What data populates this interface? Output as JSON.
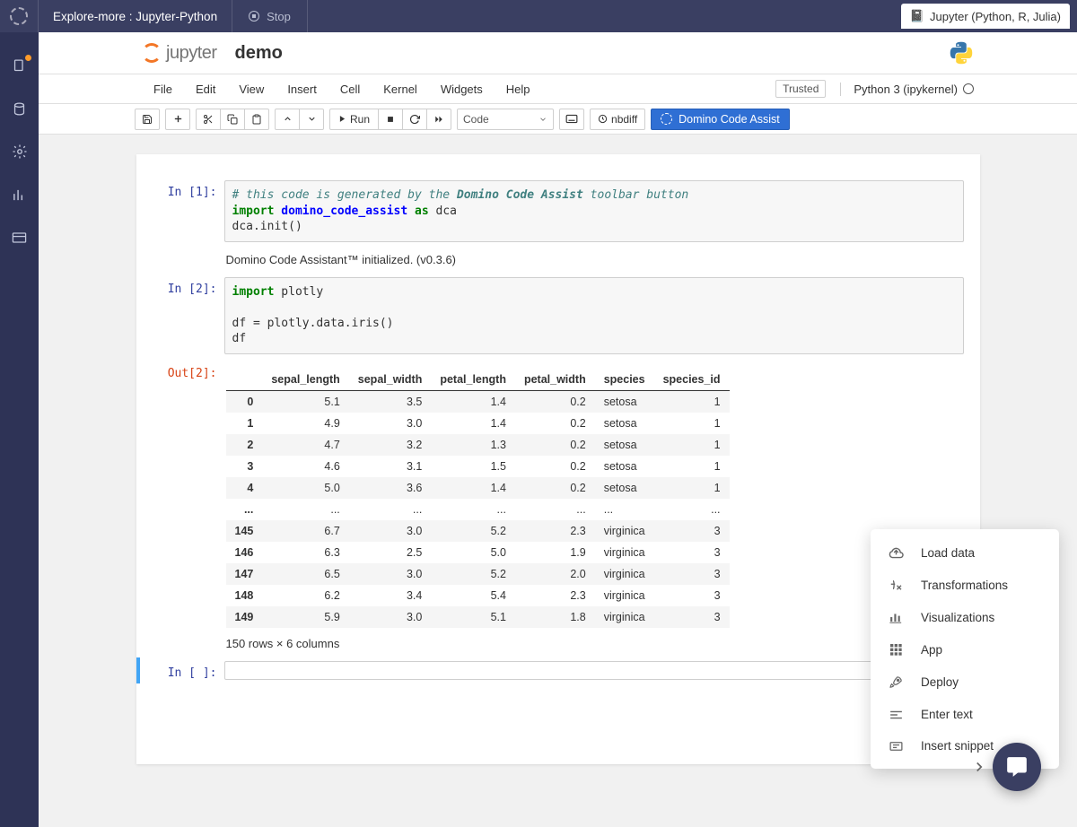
{
  "topbar": {
    "title": "Explore-more : Jupyter-Python",
    "stop_label": "Stop",
    "kernel_tab": "Jupyter (Python, R, Julia)"
  },
  "notebook": {
    "logo_text": "jupyter",
    "name": "demo",
    "trusted": "Trusted",
    "kernel": "Python 3 (ipykernel)"
  },
  "menu": {
    "items": [
      "File",
      "Edit",
      "View",
      "Insert",
      "Cell",
      "Kernel",
      "Widgets",
      "Help"
    ]
  },
  "toolbar": {
    "run_label": "Run",
    "celltype": "Code",
    "nbdiff": "nbdiff",
    "assist": "Domino Code Assist"
  },
  "cells": {
    "c1": {
      "prompt": "In [1]:",
      "comment": "# this code is generated by the ",
      "comment_emph": "Domino Code Assist",
      "comment_tail": " toolbar button",
      "l2a": "import",
      "l2b": " domino_code_assist ",
      "l2c": "as",
      "l2d": " dca",
      "l3": "dca.init()",
      "out_text": "Domino Code Assistant™ initialized. (v0.3.6)"
    },
    "c2": {
      "prompt": "In [2]:",
      "l1a": "import",
      "l1b": " plotly",
      "l3": "df = plotly.data.iris()",
      "l4": "df",
      "out_prompt": "Out[2]:"
    },
    "c3": {
      "prompt": "In [ ]:"
    }
  },
  "df": {
    "cols": [
      "sepal_length",
      "sepal_width",
      "petal_length",
      "petal_width",
      "species",
      "species_id"
    ],
    "idx": [
      "0",
      "1",
      "2",
      "3",
      "4",
      "...",
      "145",
      "146",
      "147",
      "148",
      "149"
    ],
    "rows": [
      [
        "5.1",
        "3.5",
        "1.4",
        "0.2",
        "setosa",
        "1"
      ],
      [
        "4.9",
        "3.0",
        "1.4",
        "0.2",
        "setosa",
        "1"
      ],
      [
        "4.7",
        "3.2",
        "1.3",
        "0.2",
        "setosa",
        "1"
      ],
      [
        "4.6",
        "3.1",
        "1.5",
        "0.2",
        "setosa",
        "1"
      ],
      [
        "5.0",
        "3.6",
        "1.4",
        "0.2",
        "setosa",
        "1"
      ],
      [
        "...",
        "...",
        "...",
        "...",
        "...",
        "..."
      ],
      [
        "6.7",
        "3.0",
        "5.2",
        "2.3",
        "virginica",
        "3"
      ],
      [
        "6.3",
        "2.5",
        "5.0",
        "1.9",
        "virginica",
        "3"
      ],
      [
        "6.5",
        "3.0",
        "5.2",
        "2.0",
        "virginica",
        "3"
      ],
      [
        "6.2",
        "3.4",
        "5.4",
        "2.3",
        "virginica",
        "3"
      ],
      [
        "5.9",
        "3.0",
        "5.1",
        "1.8",
        "virginica",
        "3"
      ]
    ],
    "dims": "150 rows × 6 columns"
  },
  "floatmenu": {
    "items": [
      "Load data",
      "Transformations",
      "Visualizations",
      "App",
      "Deploy",
      "Enter text",
      "Insert snippet"
    ]
  }
}
